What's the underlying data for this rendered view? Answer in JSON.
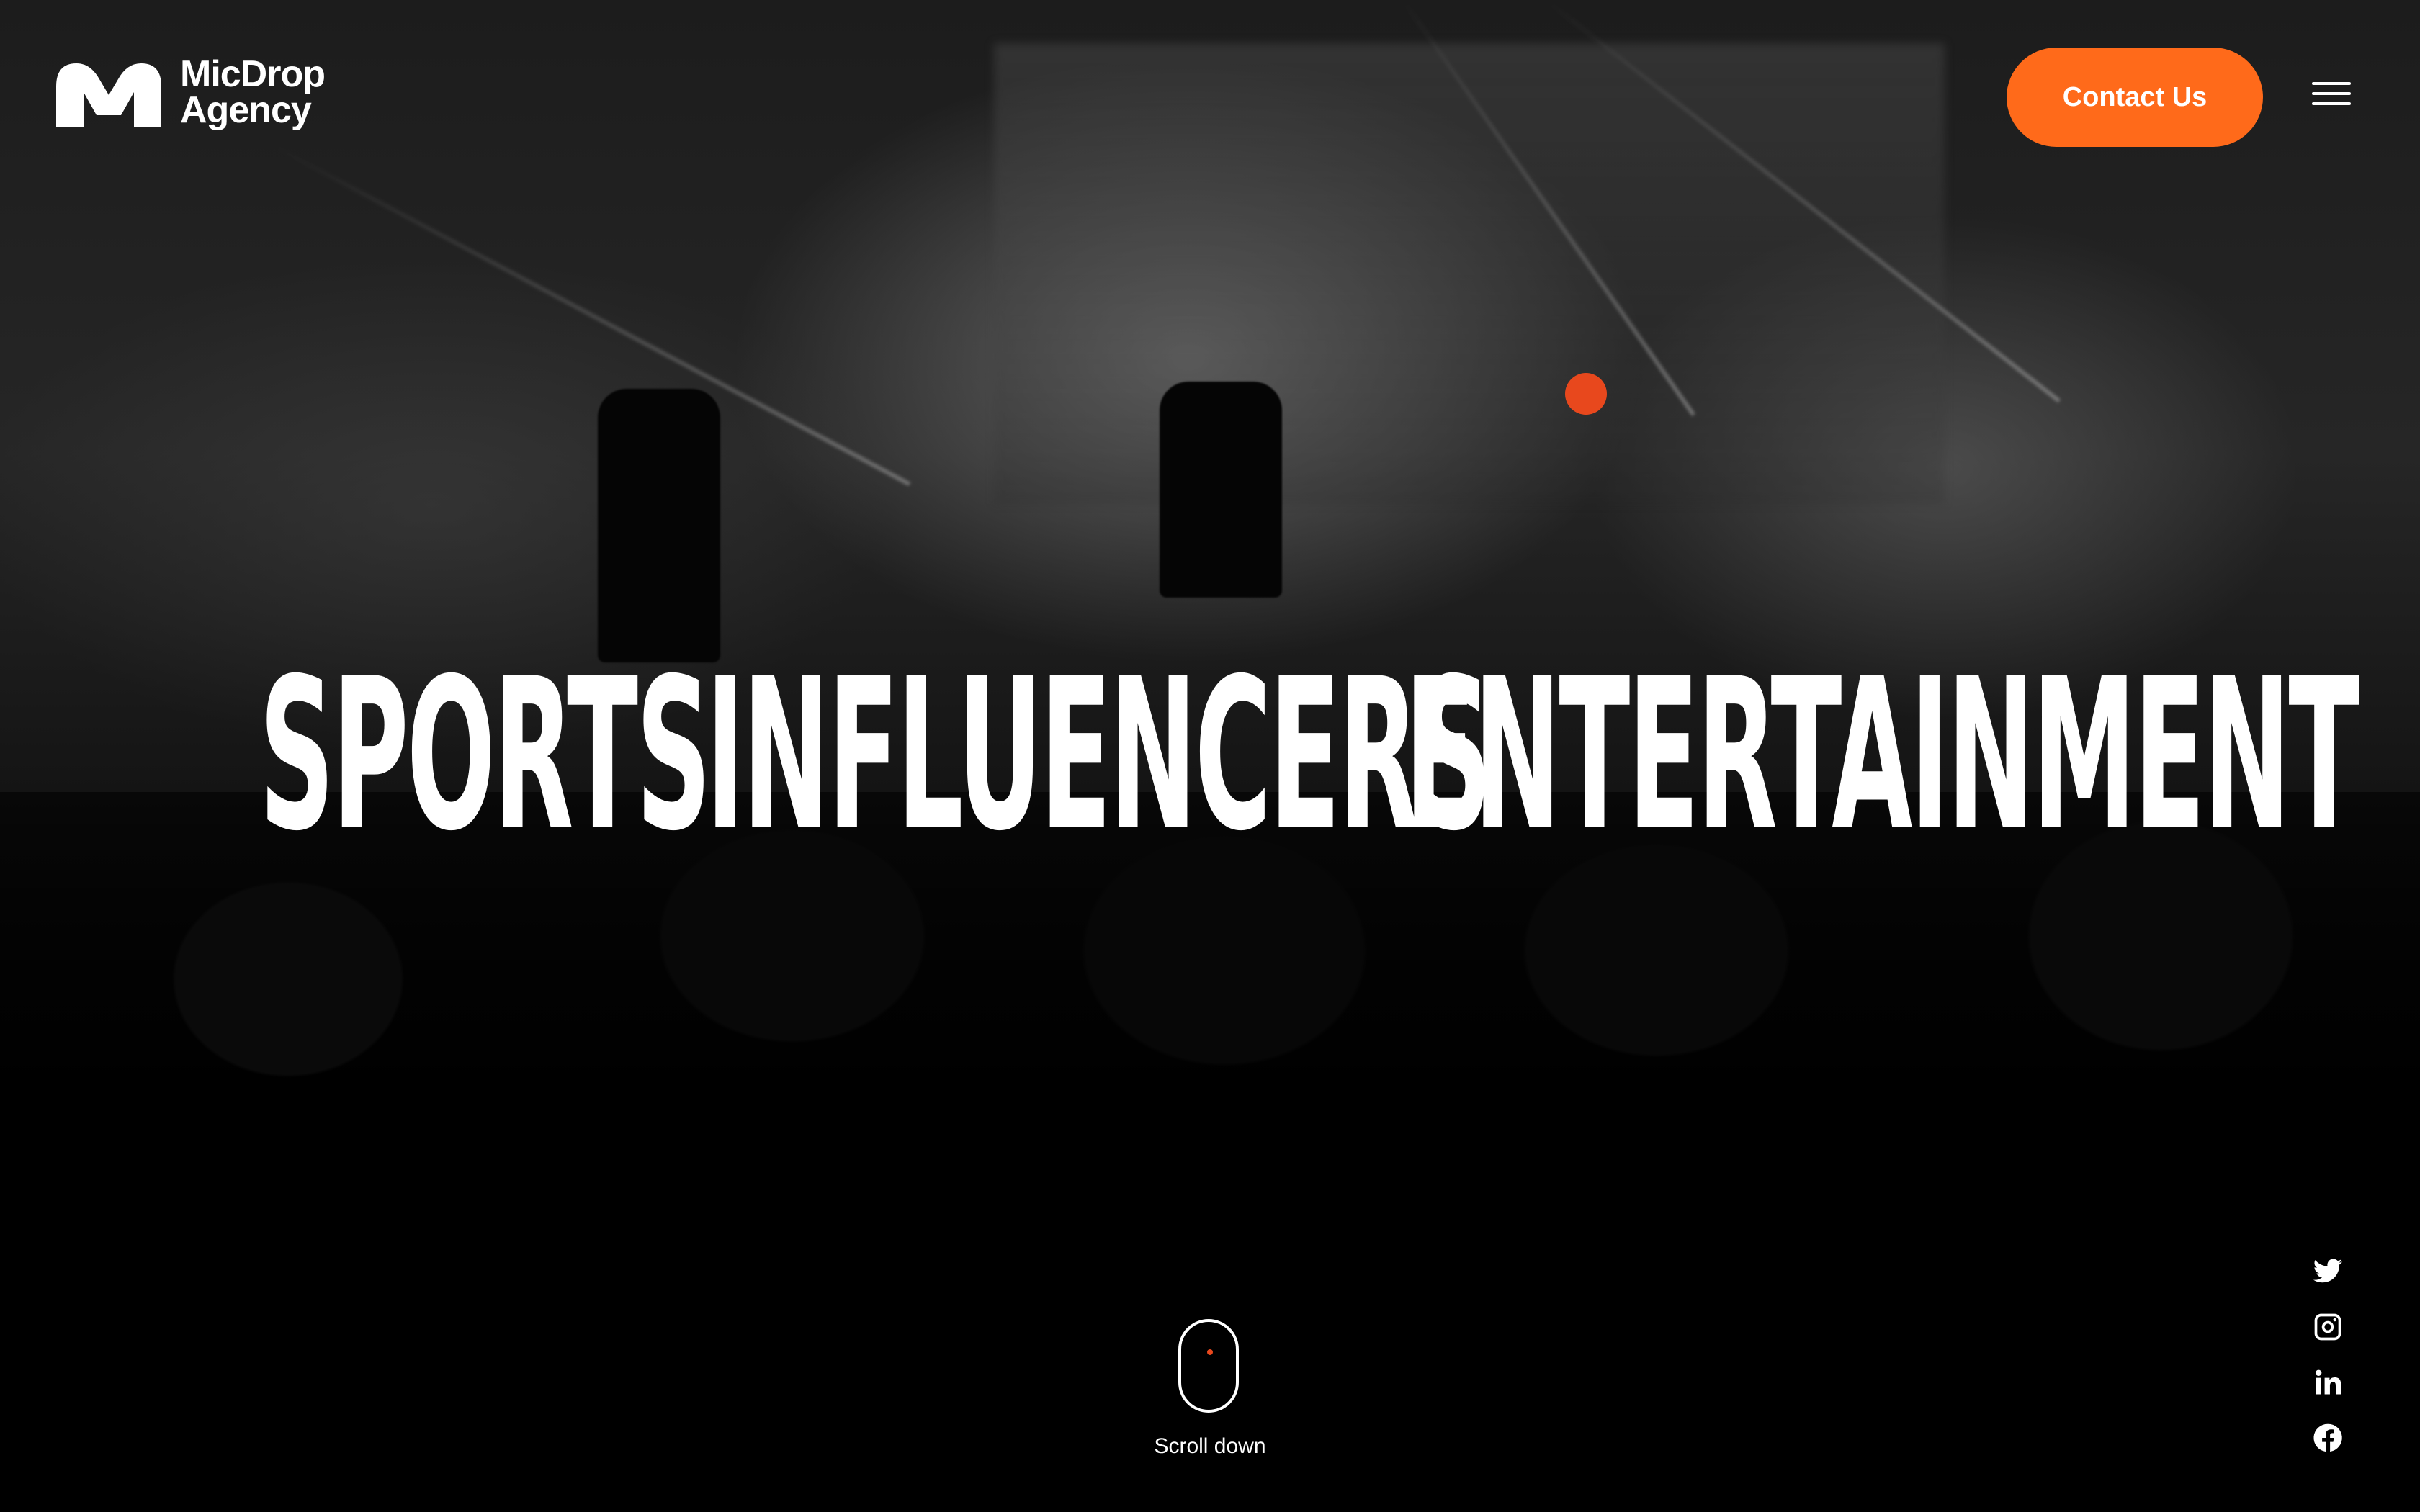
{
  "brand": {
    "name_line1": "MicDrop",
    "name_line2": "Agency",
    "logo_icon": "m-logo-icon",
    "accent_color": "#ff6a1a"
  },
  "header": {
    "contact_label": "Contact Us",
    "menu_icon": "hamburger-menu-icon"
  },
  "hero": {
    "words": [
      "SPORTS",
      "INFLUENCERS",
      "ENTERTAINMENT"
    ],
    "scroll_label": "Scroll down"
  },
  "social": {
    "items": [
      {
        "icon": "twitter-icon"
      },
      {
        "icon": "instagram-icon"
      },
      {
        "icon": "linkedin-icon"
      },
      {
        "icon": "facebook-icon"
      }
    ]
  }
}
